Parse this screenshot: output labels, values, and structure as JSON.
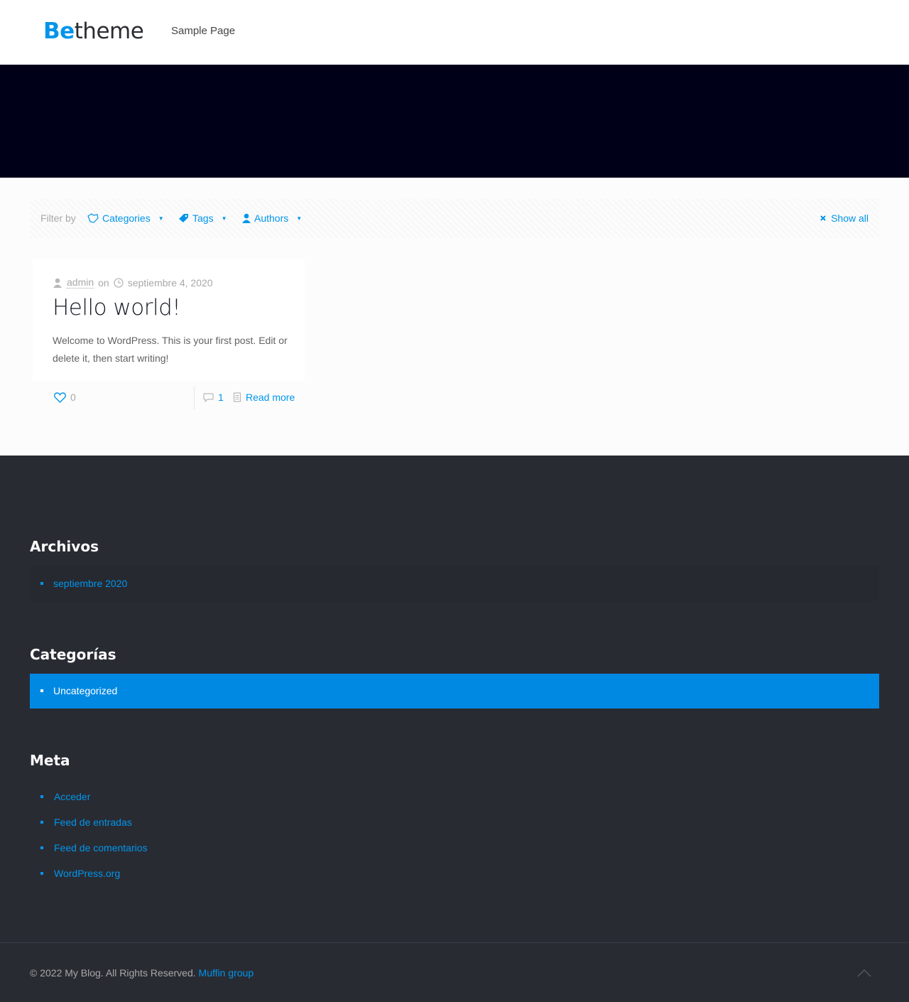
{
  "header": {
    "logo_be": "Be",
    "logo_theme": "theme",
    "nav": [
      {
        "label": "Sample Page"
      }
    ]
  },
  "filters": {
    "label": "Filter by",
    "categories": "Categories",
    "tags": "Tags",
    "authors": "Authors",
    "show_all": "Show all"
  },
  "post": {
    "author": "admin",
    "on": "on",
    "date": "septiembre 4, 2020",
    "title": "Hello world!",
    "excerpt": "Welcome to WordPress. This is your first post. Edit or delete it, then start writing!",
    "likes": "0",
    "comments": "1",
    "read_more": "Read more"
  },
  "footer": {
    "archives_title": "Archivos",
    "archives": [
      "septiembre 2020"
    ],
    "categories_title": "Categorías",
    "categories": [
      "Uncategorized"
    ],
    "meta_title": "Meta",
    "meta": [
      "Acceder",
      "Feed de entradas",
      "Feed de comentarios",
      "WordPress.org"
    ],
    "copyright": "© 2022 My Blog. All Rights Reserved.",
    "copyright_link": "Muffin group"
  },
  "colors": {
    "accent": "#0095eb",
    "hero": "#000119",
    "footer_bg": "#292b33",
    "category_highlight": "#0089e3"
  },
  "icons": [
    "user-icon",
    "clock-icon",
    "heart-icon",
    "comment-icon",
    "document-icon",
    "folder-icon",
    "tag-icon",
    "person-icon",
    "close-icon",
    "chevron-up-icon"
  ]
}
